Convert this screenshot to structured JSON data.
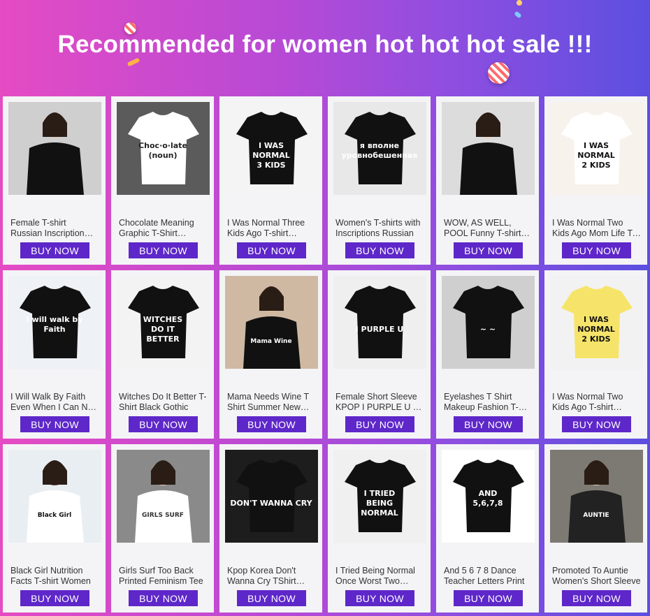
{
  "banner": {
    "title": "Recommended for women hot hot hot sale !!!"
  },
  "colors": {
    "button": "#5e27c9",
    "card": "#f4f4f6",
    "gradient_left": "#e54bc3",
    "gradient_right": "#5b4fe0"
  },
  "products": [
    {
      "title": "Female T-shirt Russian Inscription Harajuku Tumblr",
      "button": "BUY NOW",
      "image": "photo-women-black-tees-icon"
    },
    {
      "title": "Chocolate Meaning Graphic T-Shirt Women",
      "button": "BUY NOW",
      "image": "white-tee-chocolate-icon"
    },
    {
      "title": "I Was Normal Three Kids Ago T-shirt Casual",
      "button": "BUY NOW",
      "image": "black-tee-3-kids-icon"
    },
    {
      "title": "Women's T-shirts with Inscriptions Russian",
      "button": "BUY NOW",
      "image": "black-tee-russian-text-icon"
    },
    {
      "title": "WOW, AS WELL, POOL Funny T-shirt Women",
      "button": "BUY NOW",
      "image": "photo-women-wow-icon"
    },
    {
      "title": "I Was Normal Two Kids Ago Mom Life T-Shirt",
      "button": "BUY NOW",
      "image": "white-tee-2-kids-icon"
    },
    {
      "title": "I Will Walk By Faith Even When I Can Not See",
      "button": "BUY NOW",
      "image": "black-tee-faith-icon"
    },
    {
      "title": "Witches Do It Better T-Shirt Black Gothic",
      "button": "BUY NOW",
      "image": "witches-tee-icon"
    },
    {
      "title": "Mama Needs Wine T Shirt Summer New Women",
      "button": "BUY NOW",
      "image": "mama-wine-tee-icon"
    },
    {
      "title": "Female Short Sleeve KPOP I PURPLE U T-shirt",
      "button": "BUY NOW",
      "image": "purple-u-tee-icon"
    },
    {
      "title": "Eyelashes T Shirt Makeup Fashion T-shirt",
      "button": "BUY NOW",
      "image": "eyelashes-tee-icon"
    },
    {
      "title": "I Was Normal Two Kids Ago T-shirt Women",
      "button": "BUY NOW",
      "image": "yellow-tee-2-kids-icon"
    },
    {
      "title": "Black Girl Nutrition Facts T-shirt Women",
      "button": "BUY NOW",
      "image": "nutrition-facts-photo-icon"
    },
    {
      "title": "Girls Surf Too Back Printed Feminism Tee",
      "button": "BUY NOW",
      "image": "girls-surf-too-photo-icon"
    },
    {
      "title": "Kpop Korea Don't Wanna Cry TShirt Women",
      "button": "BUY NOW",
      "image": "dont-wanna-cry-tee-icon"
    },
    {
      "title": "I Tried Being Normal Once Worst Two Minutes",
      "button": "BUY NOW",
      "image": "tried-normal-tee-icon"
    },
    {
      "title": "And 5 6 7 8 Dance Teacher Letters Print",
      "button": "BUY NOW",
      "image": "and-5678-tee-icon"
    },
    {
      "title": "Promoted To Auntie Women's Short Sleeve",
      "button": "BUY NOW",
      "image": "promoted-auntie-photo-icon"
    }
  ]
}
